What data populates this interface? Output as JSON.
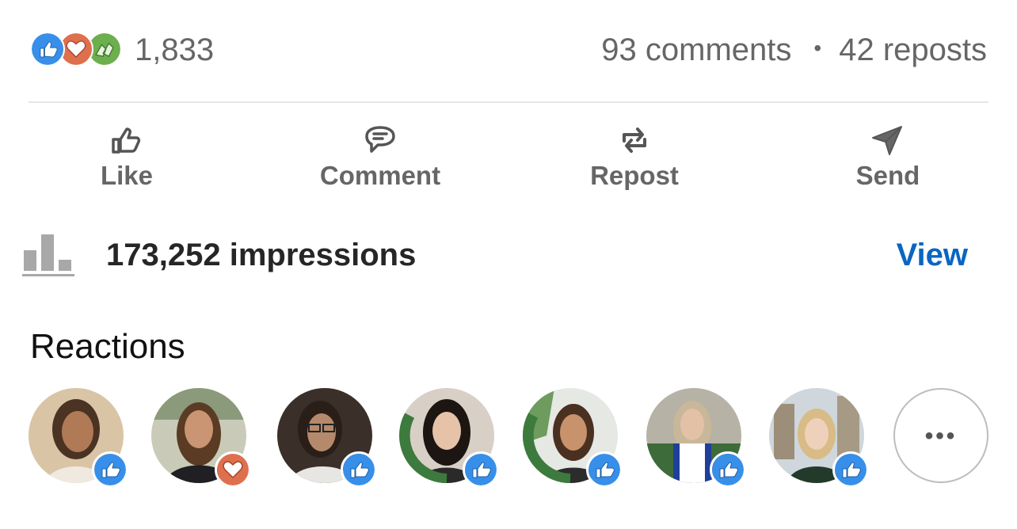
{
  "summary": {
    "reaction_icons": [
      "like-icon",
      "love-icon",
      "celebrate-icon"
    ],
    "reaction_count": "1,833",
    "comments": "93 comments",
    "separator": "•",
    "reposts": "42 reposts"
  },
  "actions": [
    {
      "label": "Like",
      "icon": "thumbs-up-outline-icon"
    },
    {
      "label": "Comment",
      "icon": "speech-bubble-icon"
    },
    {
      "label": "Repost",
      "icon": "repost-arrows-icon"
    },
    {
      "label": "Send",
      "icon": "paper-plane-icon"
    }
  ],
  "impressions": {
    "icon": "bar-chart-icon",
    "text": "173,252 impressions",
    "link": "View"
  },
  "reactions": {
    "title": "Reactions",
    "people": [
      {
        "reaction": "like",
        "frame": "none"
      },
      {
        "reaction": "love",
        "frame": "none"
      },
      {
        "reaction": "like",
        "frame": "none"
      },
      {
        "reaction": "like",
        "frame": "#OPENTOWORK"
      },
      {
        "reaction": "like",
        "frame": "#OPENTOWORK"
      },
      {
        "reaction": "like",
        "frame": "none"
      },
      {
        "reaction": "like",
        "frame": "none"
      }
    ],
    "more_label": "•••"
  },
  "colors": {
    "like": "#378fe9",
    "love": "#df704d",
    "celebrate": "#6dae4f",
    "link": "#0a66c2",
    "muted_text": "#666666",
    "open_to_work": "#3d7a3e"
  }
}
